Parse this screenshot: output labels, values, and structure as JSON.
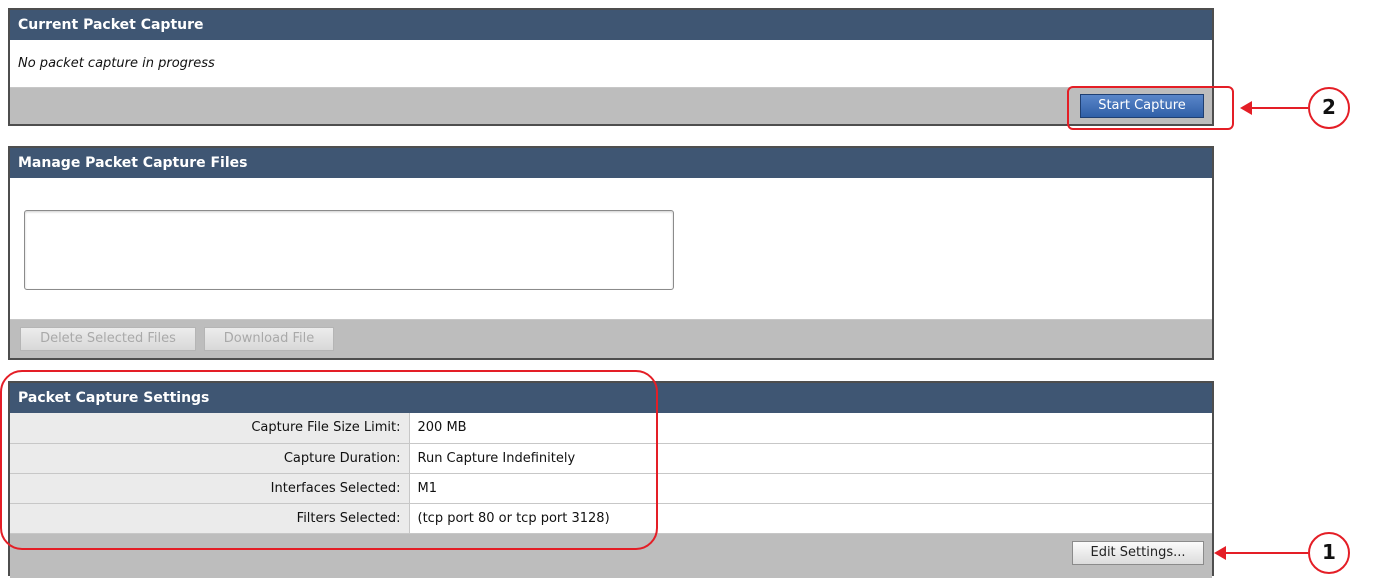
{
  "current_capture": {
    "title": "Current Packet Capture",
    "status": "No packet capture in progress",
    "start_button": "Start Capture"
  },
  "manage_files": {
    "title": "Manage Packet Capture Files",
    "delete_button": "Delete Selected Files",
    "download_button": "Download File"
  },
  "settings": {
    "title": "Packet Capture Settings",
    "rows": [
      {
        "label": "Capture File Size Limit:",
        "value": "200 MB"
      },
      {
        "label": "Capture Duration:",
        "value": "Run Capture Indefinitely"
      },
      {
        "label": "Interfaces Selected:",
        "value": "M1"
      },
      {
        "label": "Filters Selected:",
        "value": "(tcp port 80 or tcp port 3128)"
      }
    ],
    "edit_button": "Edit Settings..."
  },
  "annotations": {
    "callout_1": "1",
    "callout_2": "2",
    "color": "#e41e26"
  }
}
